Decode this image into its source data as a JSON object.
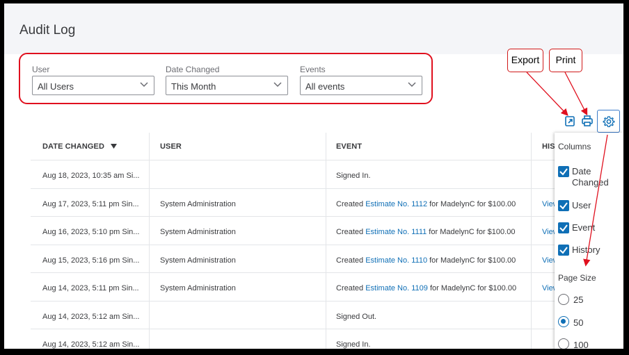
{
  "page": {
    "title": "Audit Log"
  },
  "filters": {
    "user": {
      "label": "User",
      "value": "All Users"
    },
    "date_changed": {
      "label": "Date Changed",
      "value": "This Month"
    },
    "events": {
      "label": "Events",
      "value": "All events"
    }
  },
  "callouts": {
    "export": "Export",
    "print": "Print"
  },
  "toolbar": {
    "export_icon": "export-icon",
    "print_icon": "printer-icon",
    "settings_icon": "gear-icon"
  },
  "table": {
    "headers": {
      "date": "DATE CHANGED",
      "user": "USER",
      "event": "EVENT",
      "history": "HIST"
    },
    "rows": [
      {
        "date": "Aug 18, 2023, 10:35 am Si...",
        "user": "",
        "event_pre": "Signed In.",
        "event_link": "",
        "event_post": "",
        "history": ""
      },
      {
        "date": "Aug 17, 2023, 5:11 pm Sin...",
        "user": "System Administration",
        "event_pre": "Created ",
        "event_link": "Estimate No. 1112",
        "event_post": " for MadelynC for $100.00",
        "history": "View"
      },
      {
        "date": "Aug 16, 2023, 5:10 pm Sin...",
        "user": "System Administration",
        "event_pre": "Created ",
        "event_link": "Estimate No. 1111",
        "event_post": " for MadelynC for $100.00",
        "history": "View"
      },
      {
        "date": "Aug 15, 2023, 5:16 pm Sin...",
        "user": "System Administration",
        "event_pre": "Created ",
        "event_link": "Estimate No. 1110",
        "event_post": " for MadelynC for $100.00",
        "history": "View"
      },
      {
        "date": "Aug 14, 2023, 5:11 pm Sin...",
        "user": "System Administration",
        "event_pre": "Created ",
        "event_link": "Estimate No. 1109",
        "event_post": " for MadelynC for $100.00",
        "history": "View"
      },
      {
        "date": "Aug 14, 2023, 5:12 am Sin...",
        "user": "",
        "event_pre": "Signed Out.",
        "event_link": "",
        "event_post": "",
        "history": ""
      },
      {
        "date": "Aug 14, 2023, 5:12 am Sin...",
        "user": "",
        "event_pre": "Signed In.",
        "event_link": "",
        "event_post": "",
        "history": ""
      }
    ]
  },
  "settings_panel": {
    "columns_heading": "Columns",
    "columns": [
      {
        "label": "Date Changed",
        "checked": true
      },
      {
        "label": "User",
        "checked": true
      },
      {
        "label": "Event",
        "checked": true
      },
      {
        "label": "History",
        "checked": true
      }
    ],
    "page_size_heading": "Page Size",
    "page_sizes": [
      {
        "label": "25",
        "selected": false
      },
      {
        "label": "50",
        "selected": true
      },
      {
        "label": "100",
        "selected": false
      }
    ]
  },
  "colors": {
    "accent": "#0f6fb6",
    "annotation": "#e0101e"
  }
}
